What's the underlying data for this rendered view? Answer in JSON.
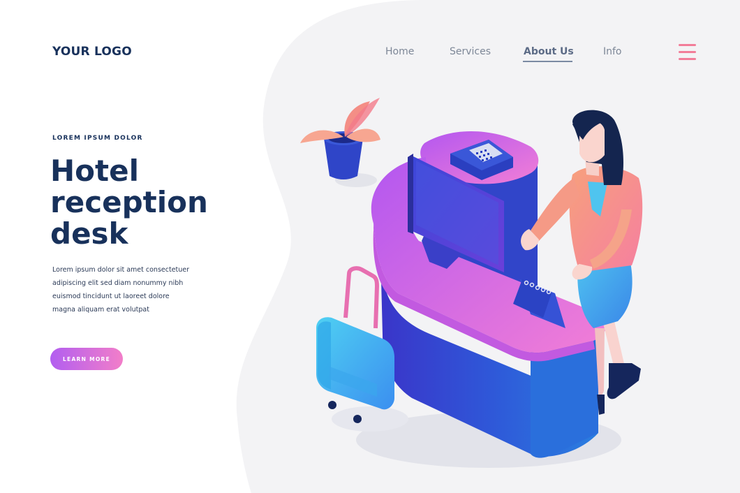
{
  "header": {
    "logo": "YOUR LOGO",
    "nav": [
      {
        "label": "Home"
      },
      {
        "label": "Services"
      },
      {
        "label": "About Us",
        "active": true
      },
      {
        "label": "Info"
      }
    ],
    "menu_icon": "hamburger-menu-icon"
  },
  "hero": {
    "eyebrow": "LOREM IPSUM DOLOR",
    "title_lines": [
      "Hotel",
      "reception",
      "desk"
    ],
    "description_lines": [
      "Lorem ipsum dolor sit amet consectetuer",
      "adipiscing elit sed diam nonummy nibh",
      "euismod tincidunt ut laoreet dolore",
      "magna aliquam erat volutpat"
    ],
    "cta_label": "LEARN MORE"
  },
  "colors": {
    "brand_navy": "#18315b",
    "accent_pink": "#f27d99",
    "cta_gradient_start": "#b25ef0",
    "cta_gradient_end": "#f27ec9"
  }
}
